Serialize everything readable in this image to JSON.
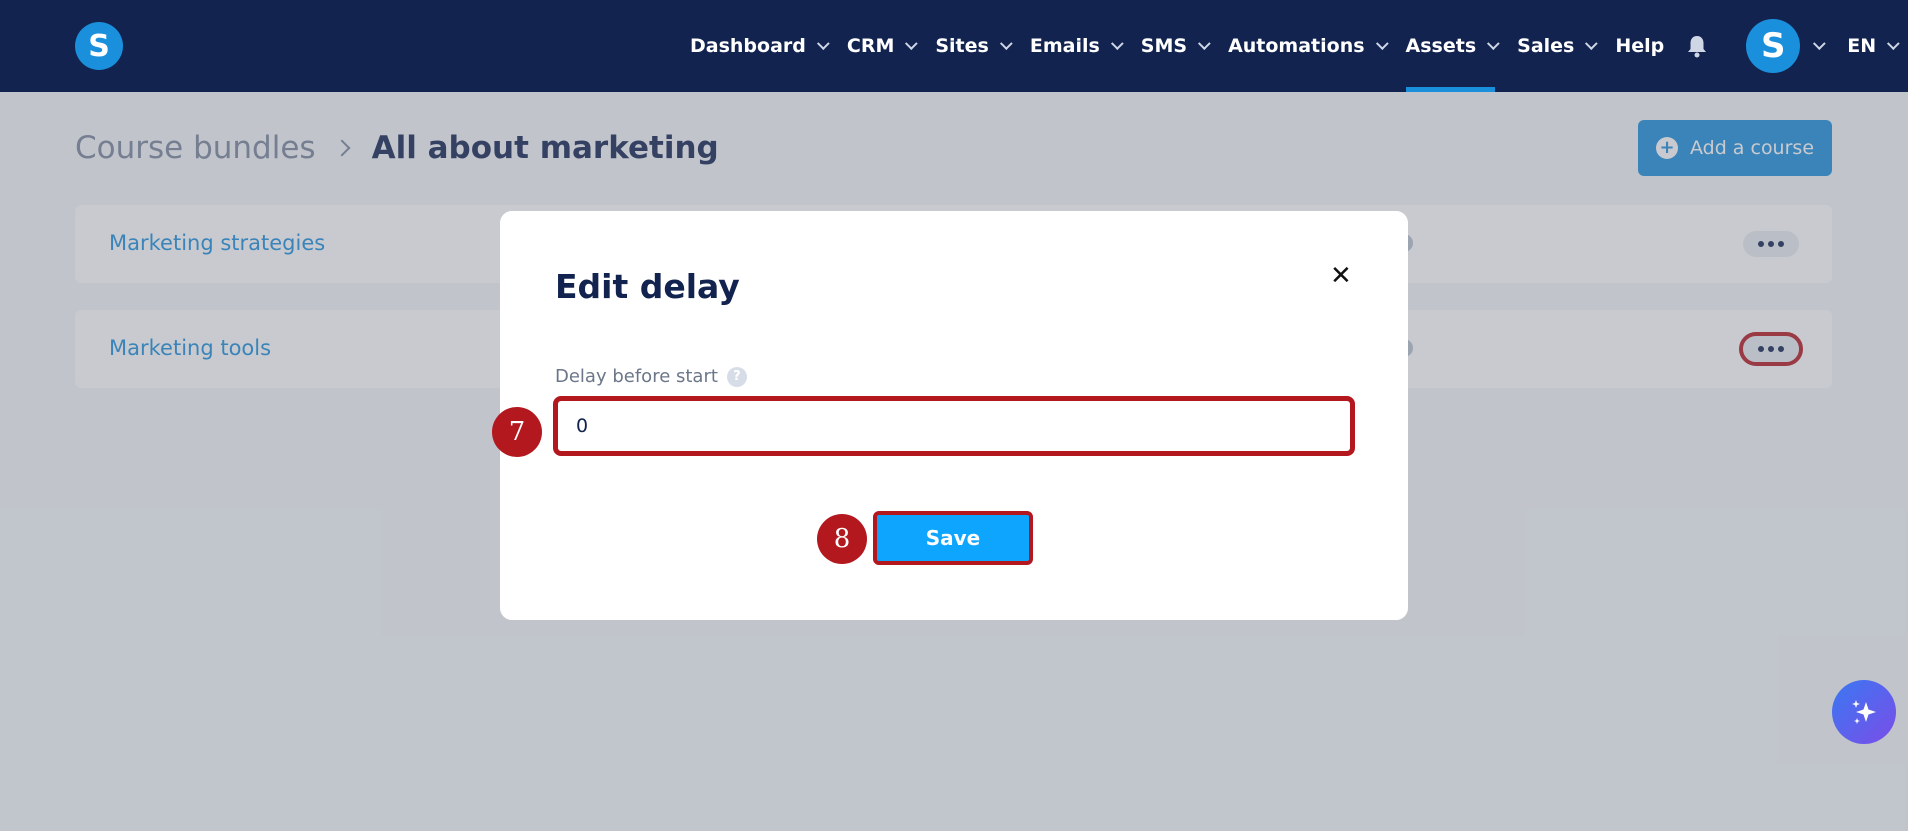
{
  "nav": {
    "logo": "S",
    "items": [
      {
        "label": "Dashboard",
        "chevron": true,
        "active": false
      },
      {
        "label": "CRM",
        "chevron": true,
        "active": false
      },
      {
        "label": "Sites",
        "chevron": true,
        "active": false
      },
      {
        "label": "Emails",
        "chevron": true,
        "active": false
      },
      {
        "label": "SMS",
        "chevron": true,
        "active": false
      },
      {
        "label": "Automations",
        "chevron": true,
        "active": false
      },
      {
        "label": "Assets",
        "chevron": true,
        "active": true
      },
      {
        "label": "Sales",
        "chevron": true,
        "active": false
      },
      {
        "label": "Help",
        "chevron": false,
        "active": false
      }
    ],
    "avatar_letter": "S",
    "language": "EN"
  },
  "breadcrumb": {
    "parent": "Course bundles",
    "current": "All about marketing"
  },
  "add_course_label": "Add a course",
  "courses": [
    {
      "title": "Marketing strategies"
    },
    {
      "title": "Marketing tools"
    }
  ],
  "modal": {
    "title": "Edit delay",
    "field_label": "Delay before start",
    "field_value": "0",
    "save_label": "Save"
  },
  "annotations": {
    "step_input": "7",
    "step_save": "8"
  },
  "colors": {
    "nav_bg": "#122350",
    "accent": "#1a8fdc",
    "save_button": "#0ea5ff",
    "highlight": "#b3181f"
  }
}
